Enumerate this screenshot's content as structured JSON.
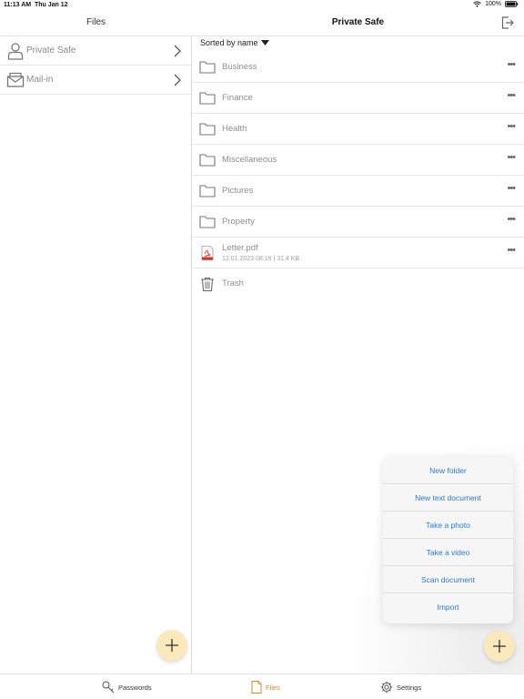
{
  "status_bar": {
    "time": "11:13 AM",
    "date": "Thu Jan 12",
    "battery": "100%"
  },
  "left_panel": {
    "title": "Files",
    "items": [
      {
        "label": "Private Safe",
        "icon": "person-icon"
      },
      {
        "label": "Mail-in",
        "icon": "mailbox-icon"
      }
    ]
  },
  "right_panel": {
    "title": "Private Safe",
    "sort_label": "Sorted by name",
    "more_glyph": "•••",
    "rows": [
      {
        "name": "Business",
        "type": "folder"
      },
      {
        "name": "Finance",
        "type": "folder"
      },
      {
        "name": "Health",
        "type": "folder"
      },
      {
        "name": "Miscellaneous",
        "type": "folder"
      },
      {
        "name": "Pictures",
        "type": "folder"
      },
      {
        "name": "Property",
        "type": "folder"
      },
      {
        "name": "Letter.pdf",
        "type": "pdf",
        "meta": "12.01.2023 08:19  |  31.4 KB"
      },
      {
        "name": "Trash",
        "type": "trash"
      }
    ]
  },
  "add_menu": {
    "items": [
      "New folder",
      "New text document",
      "Take a photo",
      "Take a video",
      "Scan document",
      "Import"
    ]
  },
  "tabbar": {
    "tabs": [
      {
        "label": "Passwords",
        "icon": "key-icon"
      },
      {
        "label": "Files",
        "icon": "file-icon",
        "active": true
      },
      {
        "label": "Settings",
        "icon": "gear-icon"
      }
    ]
  },
  "colors": {
    "accent": "#d7862d",
    "fab": "#fbe9bc",
    "link": "#2b78d6",
    "pdf_red": "#e02b2b"
  }
}
